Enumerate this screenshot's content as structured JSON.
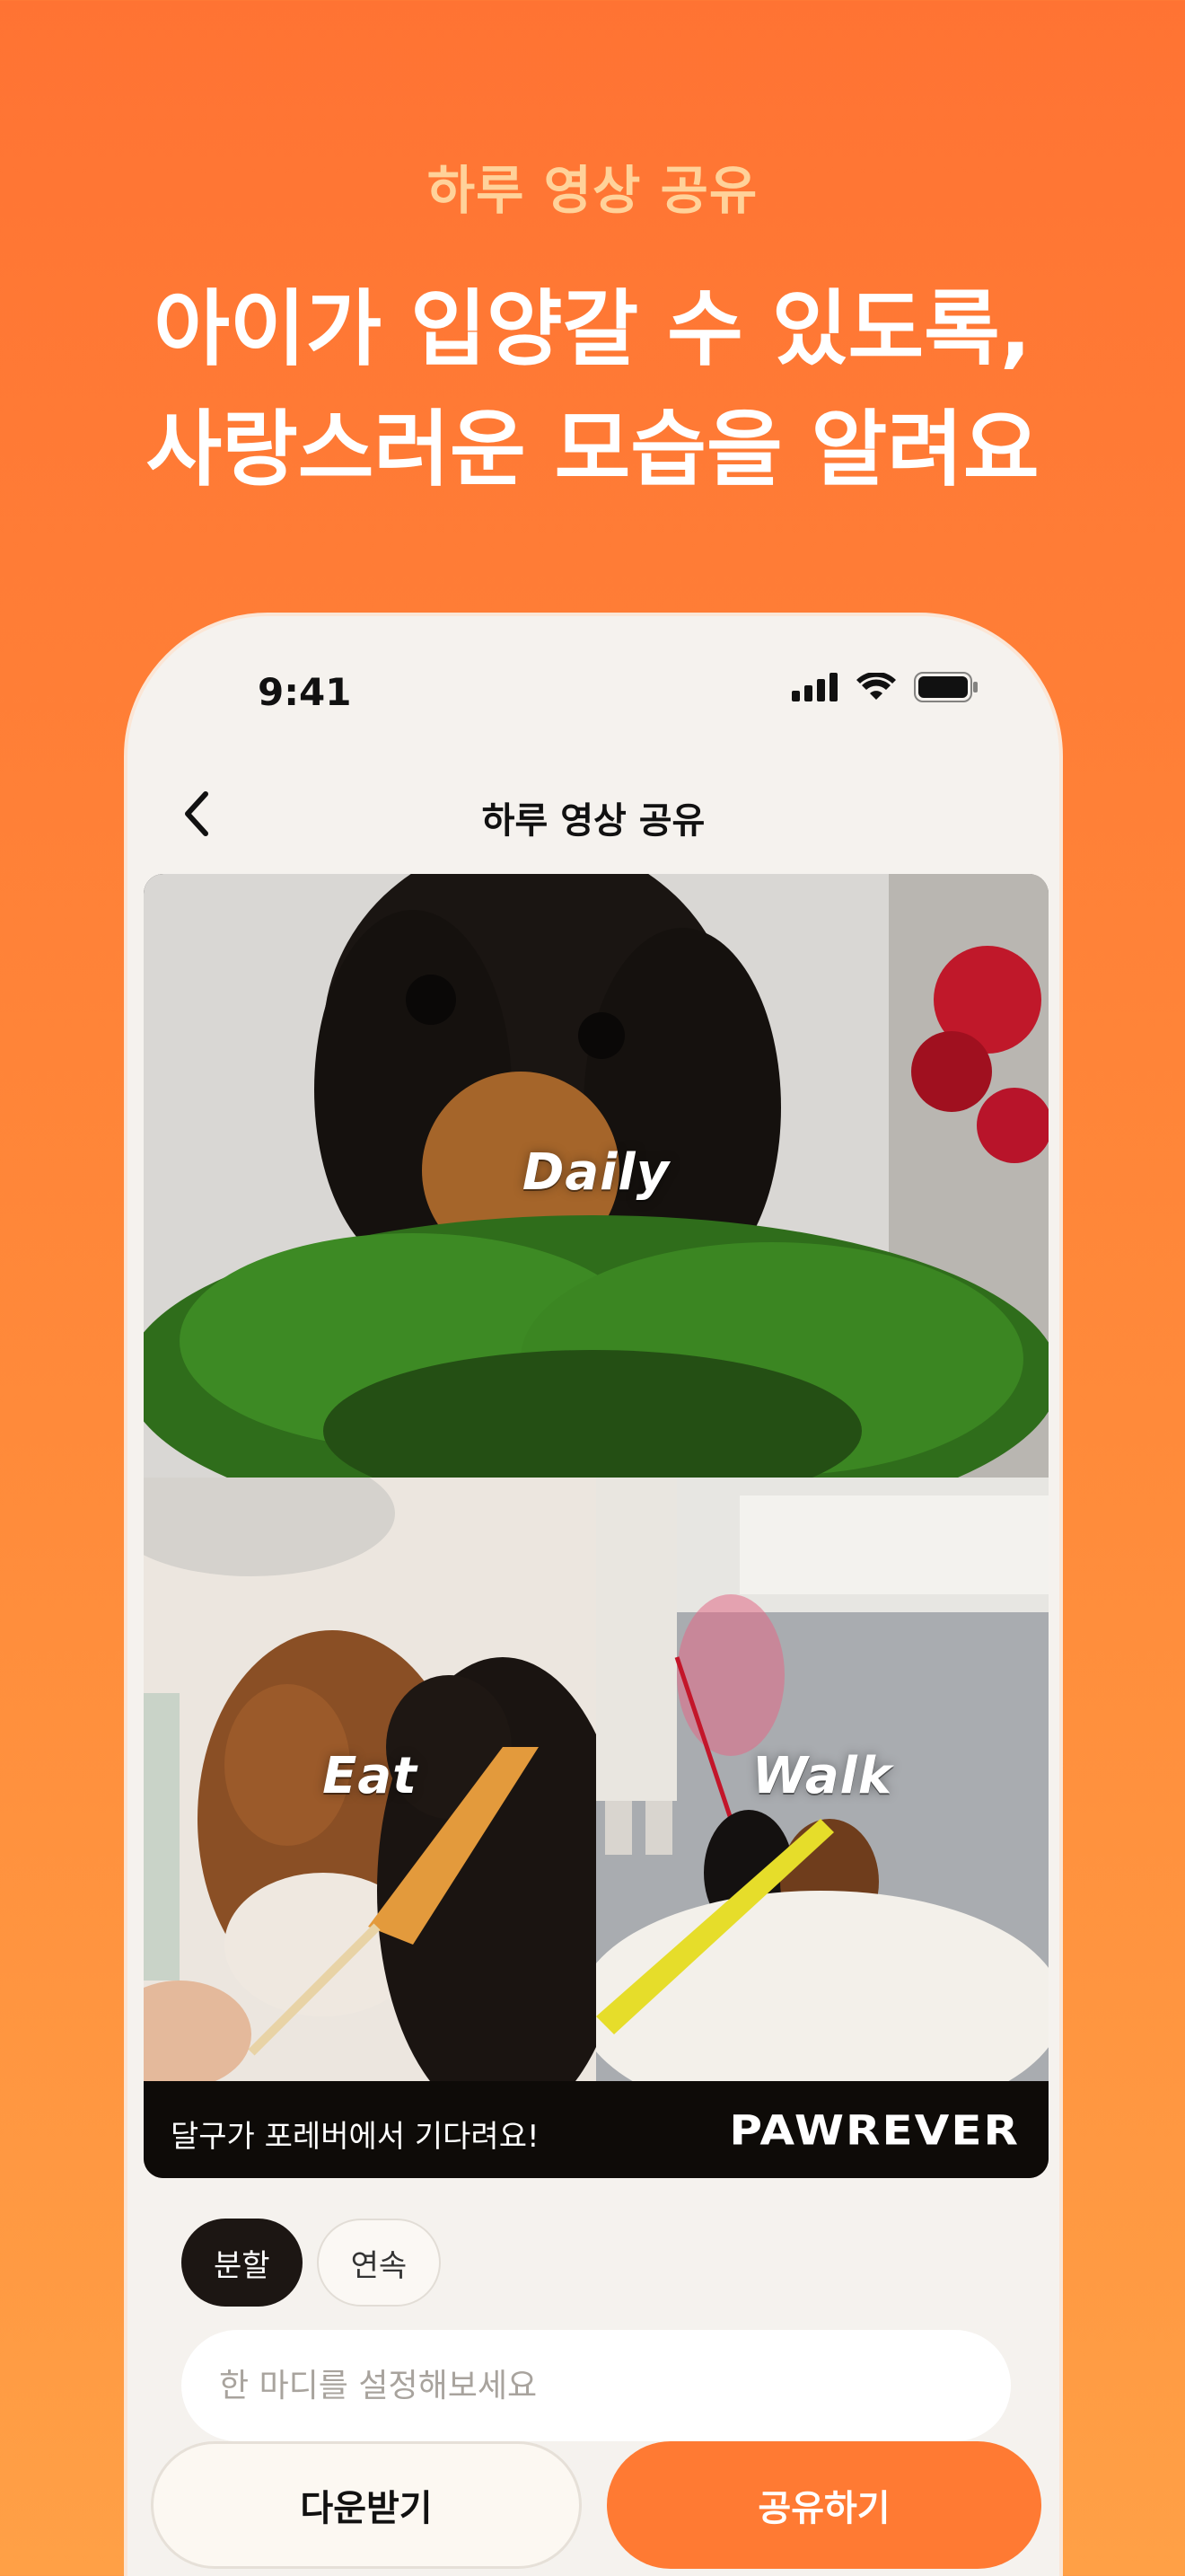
{
  "hero": {
    "eyebrow": "하루 영상 공유",
    "title_line1": "아이가 입양갈 수 있도록,",
    "title_line2": "사랑스러운 모습을 알려요"
  },
  "status_bar": {
    "time": "9:41",
    "icons": [
      "cellular-signal-icon",
      "wifi-icon",
      "battery-icon"
    ]
  },
  "nav": {
    "back_icon": "chevron-left-icon",
    "title": "하루 영상 공유"
  },
  "video": {
    "tiles": [
      {
        "label": "Daily",
        "photo": "dog-with-greens"
      },
      {
        "label": "Eat",
        "photo": "dogs-eating-treat"
      },
      {
        "label": "Walk",
        "photo": "dogs-walking-indoors"
      }
    ],
    "caption": "달구가 포레버에서 기다려요!",
    "logo": "PAWREVER"
  },
  "mode_toggle": {
    "options": [
      "분할",
      "연속"
    ],
    "selected": "분할"
  },
  "message": {
    "placeholder": "한 마디를 설정해보세요",
    "value": ""
  },
  "actions": {
    "download_label": "다운받기",
    "share_label": "공유하기"
  },
  "colors": {
    "background_top": "#ff7333",
    "background_bottom": "#ffa046",
    "accent": "#ff7a33",
    "eyebrow": "#ffd29a",
    "dark_chip": "#1c1613"
  }
}
